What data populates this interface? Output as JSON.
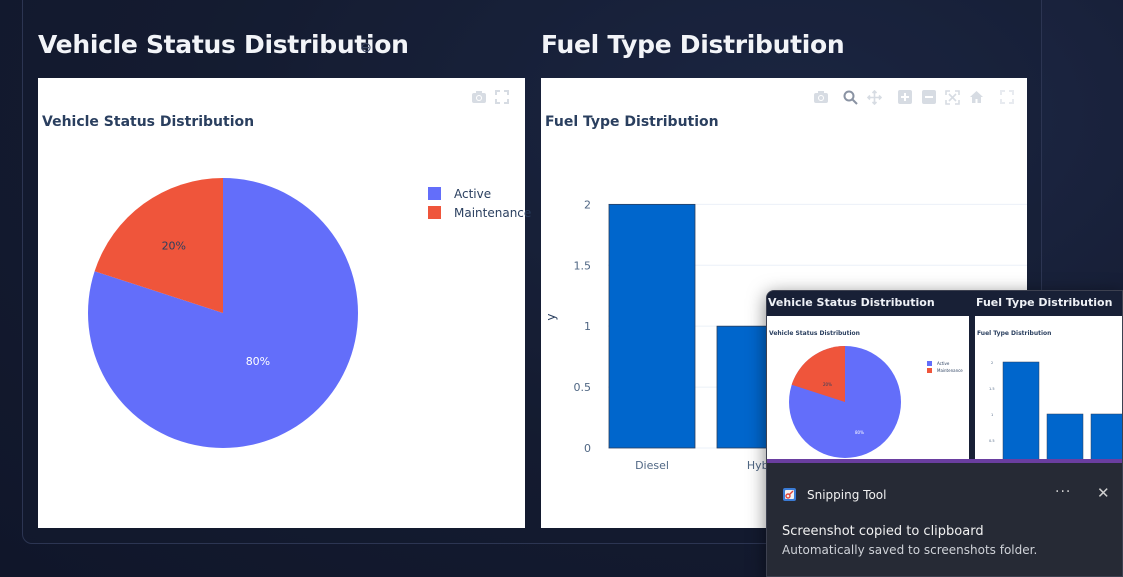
{
  "sections": {
    "left_title": "Vehicle Status Distribution",
    "right_title": "Fuel Type Distribution"
  },
  "pie_card": {
    "title": "Vehicle Status Distribution",
    "modebar_icons": [
      "camera-icon",
      "fullscreen-icon"
    ]
  },
  "bar_card": {
    "title": "Fuel Type Distribution",
    "modebar_icons": [
      "camera-icon",
      "zoom-icon",
      "pan-icon",
      "zoom-in-icon",
      "zoom-out-icon",
      "autoscale-icon",
      "reset-axes-icon",
      "fullscreen-icon"
    ]
  },
  "chart_data": [
    {
      "type": "pie",
      "title": "Vehicle Status Distribution",
      "labels": [
        "Active",
        "Maintenance"
      ],
      "values": [
        80,
        20
      ],
      "text_labels": [
        "80%",
        "20%"
      ],
      "colors": [
        "#636efa",
        "#ef553b"
      ],
      "legend_position": "top-right"
    },
    {
      "type": "bar",
      "title": "Fuel Type Distribution",
      "categories": [
        "Diesel",
        "Hybr"
      ],
      "values": [
        2,
        1
      ],
      "ylabel": "y",
      "yticks": [
        "0",
        "0.5",
        "1",
        "1.5",
        "2"
      ],
      "ylim": [
        0,
        2.2
      ],
      "color": "#0066cc",
      "grid": true
    }
  ],
  "toast": {
    "thumbnail": {
      "left_title": "Vehicle Status Distribution",
      "right_title": "Fuel Type Distribution",
      "pie_card_title": "Vehicle Status Distribution",
      "bar_card_title": "Fuel Type Distribution",
      "legend": [
        "Active",
        "Maintenance"
      ],
      "pie_labels": [
        "20%",
        "80%"
      ],
      "y_ticks": [
        "2",
        "1.5",
        "1",
        "0.5"
      ]
    },
    "app_name": "Snipping Tool",
    "app_icon": "snipping-tool-icon",
    "more_label": "···",
    "close_label": "✕",
    "message": "Screenshot copied to clipboard",
    "detail": "Automatically saved to screenshots folder."
  }
}
